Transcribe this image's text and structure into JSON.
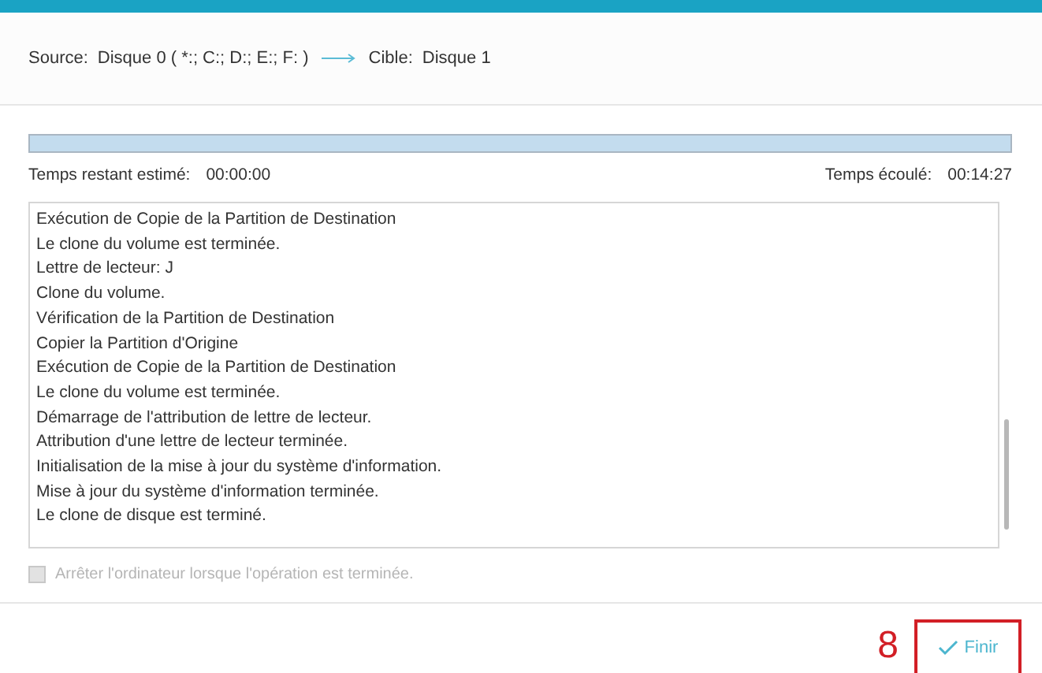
{
  "header": {
    "source_label": "Source:",
    "source_value": "Disque 0 ( *:; C:; D:; E:; F: )",
    "target_label": "Cible:",
    "target_value": "Disque 1"
  },
  "progress": {
    "level": 1,
    "remaining_label": "Temps restant estimé:",
    "remaining_value": "00:00:00",
    "elapsed_label": "Temps écoulé:",
    "elapsed_value": "00:14:27"
  },
  "log": [
    "Exécution de Copie de la Partition de Destination",
    "Le clone du volume est terminée.",
    "Lettre de lecteur: J",
    "Clone du volume.",
    "Vérification de la Partition de Destination",
    "Copier la Partition d'Origine",
    "Exécution de Copie de la Partition de Destination",
    "Le clone du volume est terminée.",
    "Démarrage de l'attribution de lettre de lecteur.",
    "Attribution d'une lettre de lecteur terminée.",
    "Initialisation de la mise à jour du système d'information.",
    "Mise à jour du système d'information terminée.",
    "Le clone de disque est terminé."
  ],
  "shutdown_option": {
    "label": "Arrêter l'ordinateur lorsque l'opération est terminée.",
    "checked": false,
    "disabled": true
  },
  "annotation": {
    "step": "8"
  },
  "finish_button": {
    "label": "Finir"
  }
}
